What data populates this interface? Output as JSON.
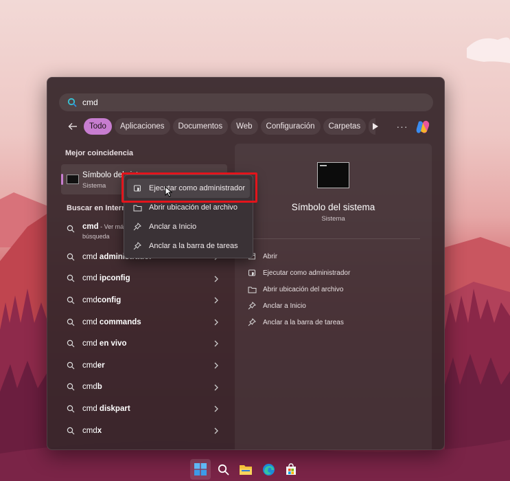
{
  "search": {
    "query": "cmd"
  },
  "filters": [
    {
      "label": "Todo",
      "active": true
    },
    {
      "label": "Aplicaciones"
    },
    {
      "label": "Documentos"
    },
    {
      "label": "Web"
    },
    {
      "label": "Configuración"
    },
    {
      "label": "Carpetas"
    }
  ],
  "best_match": {
    "heading": "Mejor coincidencia",
    "name": "Símbolo del sistema",
    "kind": "Sistema"
  },
  "web_search": {
    "heading": "Buscar en Internet",
    "first": {
      "term": "cmd",
      "suffix": " - Ver más resultados de",
      "second_line": "búsqueda"
    },
    "items": [
      {
        "prefix": "cmd ",
        "bold": "administrador"
      },
      {
        "prefix": "cmd ",
        "bold": "ipconfig"
      },
      {
        "prefix": "cmd",
        "bold": "config"
      },
      {
        "prefix": "cmd ",
        "bold": "commands"
      },
      {
        "prefix": "cmd ",
        "bold": "en vivo"
      },
      {
        "prefix": "cmd",
        "bold": "er"
      },
      {
        "prefix": "cmd",
        "bold": "b"
      },
      {
        "prefix": "cmd ",
        "bold": "diskpart"
      },
      {
        "prefix": "cmd",
        "bold": "x"
      }
    ]
  },
  "detail": {
    "title": "Símbolo del sistema",
    "subtitle": "Sistema",
    "actions": [
      {
        "label": "Abrir",
        "icon": "open-icon"
      },
      {
        "label": "Ejecutar como administrador",
        "icon": "shield-icon"
      },
      {
        "label": "Abrir ubicación del archivo",
        "icon": "folder-icon"
      },
      {
        "label": "Anclar a Inicio",
        "icon": "pin-icon"
      },
      {
        "label": "Anclar a la barra de tareas",
        "icon": "pin-icon"
      }
    ]
  },
  "context_menu": {
    "items": [
      {
        "label": "Ejecutar como administrador",
        "icon": "shield-icon"
      },
      {
        "label": "Abrir ubicación del archivo",
        "icon": "folder-icon"
      },
      {
        "label": "Anclar a Inicio",
        "icon": "pin-icon"
      },
      {
        "label": "Anclar a la barra de tareas",
        "icon": "pin-icon"
      }
    ]
  },
  "colors": {
    "accent": "#c77dd0",
    "highlight": "#e3141b"
  },
  "taskbar": {
    "icons": [
      "windows-start-icon",
      "search-icon",
      "file-explorer-icon",
      "edge-browser-icon",
      "store-icon"
    ]
  }
}
